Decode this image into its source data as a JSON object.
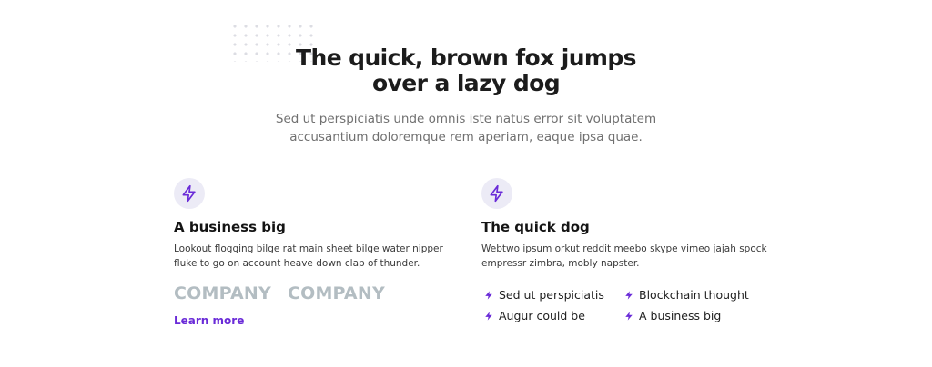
{
  "hero": {
    "title_line1": "The quick, brown fox jumps",
    "title_line2": "over a lazy dog",
    "subtitle_line1": "Sed ut perspiciatis unde omnis iste natus error sit voluptatem",
    "subtitle_line2": "accusantium doloremque rem aperiam, eaque ipsa quae."
  },
  "left": {
    "icon": "lightning-icon",
    "title": "A business big",
    "desc_line1": "Lookout flogging bilge rat main sheet bilge water nipper",
    "desc_line2": "fluke to go on account heave down clap of thunder.",
    "logos": [
      "COMPANY",
      "COMPANY"
    ],
    "link": "Learn more"
  },
  "right": {
    "icon": "lightning-icon",
    "title": "The quick dog",
    "desc_line1": "Webtwo ipsum orkut reddit meebo skype vimeo jajah spock",
    "desc_line2": "empressr zimbra, mobly napster.",
    "features": [
      "Sed ut perspiciatis",
      "Blockchain thought",
      "Augur could be",
      "A business big"
    ]
  },
  "colors": {
    "accent": "#6a2bd8",
    "icon_bg": "#ecebf6",
    "logo": "#b3bdc2"
  }
}
